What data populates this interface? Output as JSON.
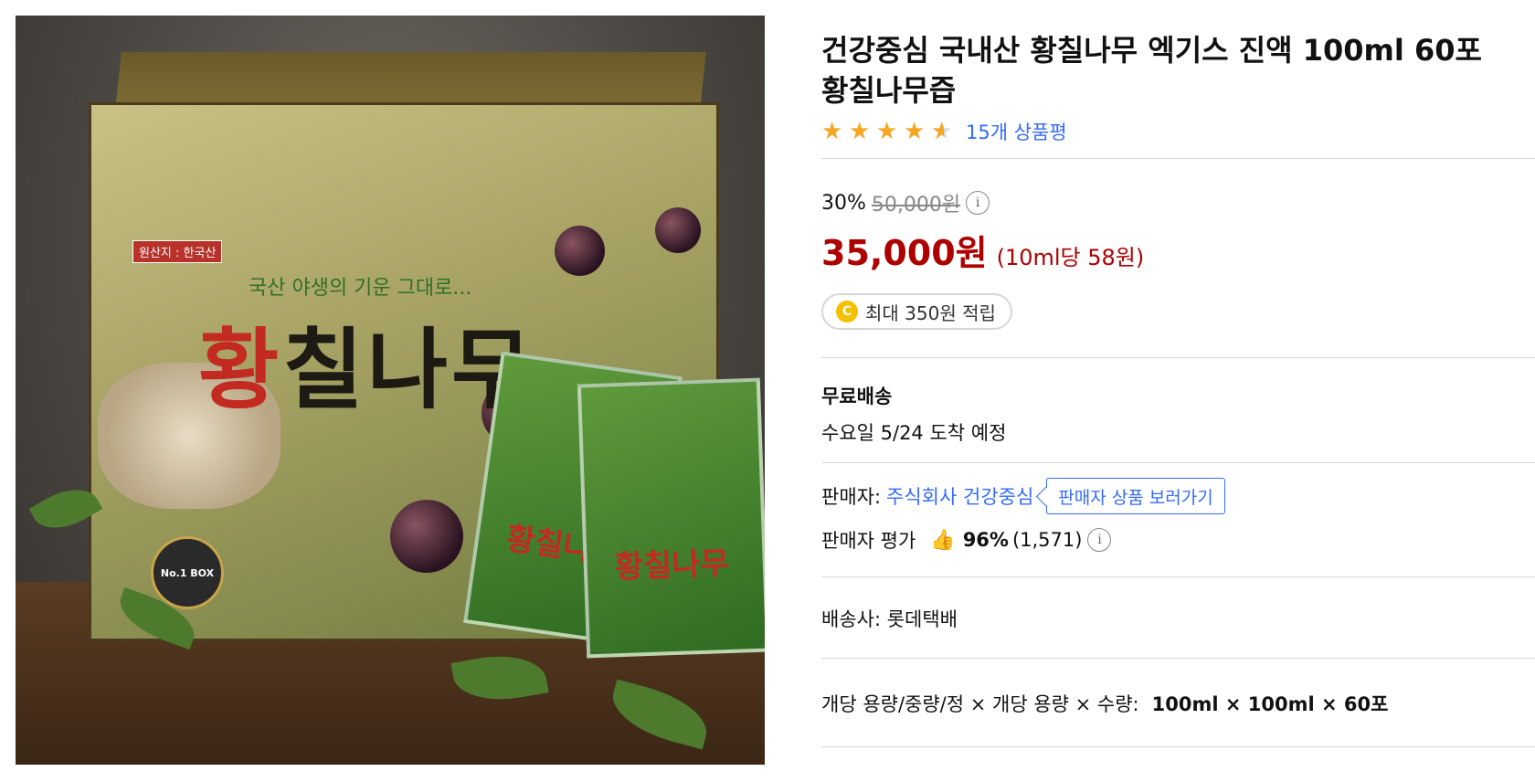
{
  "product": {
    "title_line1": "건강중심 국내산 황칠나무 엑기스 진액 100ml 60포",
    "title_line2": "황칠나무즙",
    "rating": 4.5,
    "max_rating": 5,
    "review_text": "15개 상품평"
  },
  "image": {
    "origin_label": "원산지 : 한국산",
    "tagline": "국산 야생의 기운 그대로...",
    "box_title_first": "황",
    "box_title_rest": "칠나무",
    "pouch_text": "황칠나무",
    "badge_text": "No.1 BOX"
  },
  "price": {
    "discount_rate": "30%",
    "original_price": "50,000원",
    "info_icon": "i",
    "sale_price": "35,000원",
    "unit_price": "(10ml당 58원)"
  },
  "reward": {
    "coin_icon": "C",
    "text": "최대 350원 적립"
  },
  "shipping": {
    "label": "무료배송",
    "arrival": "수요일 5/24 도착 예정"
  },
  "seller": {
    "label": "판매자:",
    "name": "주식회사 건강중심",
    "button_label": "판매자 상품 보러가기",
    "rating_label": "판매자 평가",
    "rating_percent": "96%",
    "rating_count": "(1,571)",
    "info_icon": "i"
  },
  "courier": {
    "text": "배송사: 롯데택배"
  },
  "spec": {
    "label": "개당 용량/중량/정 × 개당 용량 × 수량:",
    "value": "100ml × 100ml × 60포"
  },
  "colors": {
    "accent_blue": "#346aff",
    "sale_red": "#ae0000",
    "star_gold": "#f5a623"
  }
}
